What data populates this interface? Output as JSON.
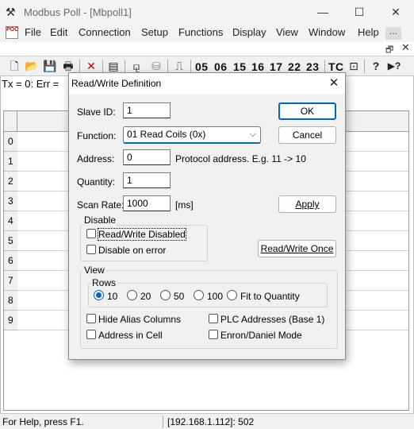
{
  "window": {
    "title": "Modbus Poll - [Mbpoll1]",
    "icon_glyph": "⚒",
    "minimize_glyph": "—",
    "maximize_glyph": "☐",
    "close_glyph": "✕"
  },
  "menu": {
    "doc_icon_text": "POC",
    "items": [
      "File",
      "Edit",
      "Connection",
      "Setup",
      "Functions",
      "Display",
      "View",
      "Window",
      "Help"
    ],
    "more_glyph": "…",
    "mdi_restore_glyph": "🗗",
    "mdi_close_glyph": "✕"
  },
  "toolbar": {
    "icons": [
      "new-icon",
      "open-icon",
      "save-icon",
      "print-icon",
      "disconnect-icon",
      "window-icon",
      "connect-icon",
      "device-icon",
      "pulse-icon"
    ],
    "icon_glyphs": [
      "🗋",
      "📂",
      "💾",
      "🖶",
      "✕",
      "▤",
      "⚼",
      "⛁",
      "⎍"
    ],
    "function_codes": [
      "05",
      "06",
      "15",
      "16",
      "17",
      "22",
      "23",
      "TC"
    ],
    "tail_icons": [
      "zoom-icon",
      "help-icon",
      "context-help-icon"
    ],
    "tail_glyphs": [
      "⊡",
      "?",
      "▶?"
    ]
  },
  "document": {
    "status_line": "Tx = 0: Err = ",
    "row_numbers": [
      "0",
      "1",
      "2",
      "3",
      "4",
      "5",
      "6",
      "7",
      "8",
      "9"
    ]
  },
  "statusbar": {
    "help": "For Help, press F1.",
    "connection": "[192.168.1.112]: 502"
  },
  "dialog": {
    "title": "Read/Write Definition",
    "close_glyph": "✕",
    "slave_id_label": "Slave ID:",
    "slave_id_value": "1",
    "function_label": "Function:",
    "function_value": "01 Read Coils (0x)",
    "address_label": "Address:",
    "address_value": "0",
    "address_hint": "Protocol address. E.g. 11 -> 10",
    "quantity_label": "Quantity:",
    "quantity_value": "1",
    "scan_rate_label": "Scan Rate:",
    "scan_rate_value": "1000",
    "scan_rate_unit": "[ms]",
    "ok_label": "OK",
    "cancel_label": "Cancel",
    "apply_label": "Apply",
    "read_write_once_label": "Read/Write Once",
    "disable_group": "Disable",
    "rw_disabled_label": "Read/Write Disabled",
    "rw_disabled_checked": false,
    "disable_on_error_label": "Disable on error",
    "disable_on_error_checked": false,
    "view_group": "View",
    "rows_group": "Rows",
    "rows_options": [
      "10",
      "20",
      "50",
      "100",
      "Fit to Quantity"
    ],
    "rows_selected": "10",
    "hide_alias_label": "Hide Alias Columns",
    "plc_addresses_label": "PLC Addresses (Base 1)",
    "address_in_cell_label": "Address in Cell",
    "enron_label": "Enron/Daniel Mode",
    "accent_color": "#0067c0"
  }
}
